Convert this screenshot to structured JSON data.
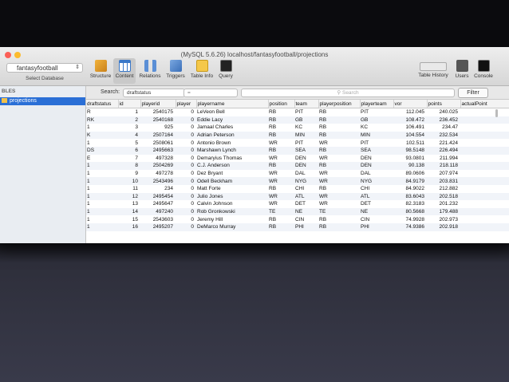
{
  "window": {
    "title": "(MySQL 5.6.26) localhost/fantasyfootball/projections"
  },
  "toolbar": {
    "database": {
      "value": "fantasyfootball",
      "label": "Select Database"
    },
    "tools": [
      {
        "label": "Structure",
        "icon": "structure-icon"
      },
      {
        "label": "Content",
        "icon": "content-icon"
      },
      {
        "label": "Relations",
        "icon": "relations-icon"
      },
      {
        "label": "Triggers",
        "icon": "triggers-icon"
      },
      {
        "label": "Table Info",
        "icon": "table-info-icon"
      },
      {
        "label": "Query",
        "icon": "query-icon"
      }
    ],
    "right_tools": [
      {
        "label": "Table History",
        "icon": "history-icon"
      },
      {
        "label": "Users",
        "icon": "users-icon"
      },
      {
        "label": "Console",
        "icon": "console-icon"
      }
    ]
  },
  "sidebar": {
    "header": "BLES",
    "items": [
      {
        "label": "projections"
      }
    ]
  },
  "filter": {
    "label": "Search:",
    "field": "draftstatus",
    "operator": "=",
    "search_placeholder": "Search",
    "button": "Filter"
  },
  "table": {
    "columns": [
      "draftstatus",
      "id",
      "playerid",
      "player",
      "playername",
      "position",
      "team",
      "playerposition",
      "playerteam",
      "vor",
      "points",
      "actualPoint"
    ],
    "rows": [
      [
        "R",
        "1",
        "2540175",
        "0",
        "LeVeon Bell",
        "RB",
        "PIT",
        "RB",
        "PIT",
        "112.045",
        "240.025",
        ""
      ],
      [
        "RK",
        "2",
        "2540168",
        "0",
        "Eddie Lacy",
        "RB",
        "GB",
        "RB",
        "GB",
        "108.472",
        "236.452",
        ""
      ],
      [
        "1",
        "3",
        "925",
        "0",
        "Jamaal Charles",
        "RB",
        "KC",
        "RB",
        "KC",
        "106.491",
        "234.47",
        ""
      ],
      [
        "K",
        "4",
        "2507164",
        "0",
        "Adrian Peterson",
        "RB",
        "MIN",
        "RB",
        "MIN",
        "104.554",
        "232.534",
        ""
      ],
      [
        "1",
        "5",
        "2508061",
        "0",
        "Antonio Brown",
        "WR",
        "PIT",
        "WR",
        "PIT",
        "102.511",
        "221.424",
        ""
      ],
      [
        "DS",
        "6",
        "2495663",
        "0",
        "Marshawn Lynch",
        "RB",
        "SEA",
        "RB",
        "SEA",
        "98.5148",
        "226.494",
        ""
      ],
      [
        "E",
        "7",
        "497328",
        "0",
        "Demaryius Thomas",
        "WR",
        "DEN",
        "WR",
        "DEN",
        "93.0801",
        "211.994",
        ""
      ],
      [
        "1",
        "8",
        "2504269",
        "0",
        "C.J. Anderson",
        "RB",
        "DEN",
        "RB",
        "DEN",
        "90.138",
        "218.118",
        ""
      ],
      [
        "1",
        "9",
        "497278",
        "0",
        "Dez Bryant",
        "WR",
        "DAL",
        "WR",
        "DAL",
        "89.0606",
        "207.974",
        ""
      ],
      [
        "1",
        "10",
        "2543496",
        "0",
        "Odell Beckham",
        "WR",
        "NYG",
        "WR",
        "NYG",
        "84.9179",
        "203.831",
        ""
      ],
      [
        "1",
        "11",
        "234",
        "0",
        "Matt Forte",
        "RB",
        "CHI",
        "RB",
        "CHI",
        "84.9022",
        "212.882",
        ""
      ],
      [
        "1",
        "12",
        "2495454",
        "0",
        "Julio Jones",
        "WR",
        "ATL",
        "WR",
        "ATL",
        "83.6043",
        "202.518",
        ""
      ],
      [
        "1",
        "13",
        "2495647",
        "0",
        "Calvin Johnson",
        "WR",
        "DET",
        "WR",
        "DET",
        "82.3183",
        "201.232",
        ""
      ],
      [
        "1",
        "14",
        "497240",
        "0",
        "Rob Gronkowski",
        "TE",
        "NE",
        "TE",
        "NE",
        "80.5668",
        "179.488",
        ""
      ],
      [
        "1",
        "15",
        "2543603",
        "0",
        "Jeremy Hill",
        "RB",
        "CIN",
        "RB",
        "CIN",
        "74.9928",
        "202.973",
        ""
      ],
      [
        "1",
        "16",
        "2495207",
        "0",
        "DeMarco Murray",
        "RB",
        "PHI",
        "RB",
        "PHI",
        "74.9386",
        "202.918",
        ""
      ]
    ]
  }
}
